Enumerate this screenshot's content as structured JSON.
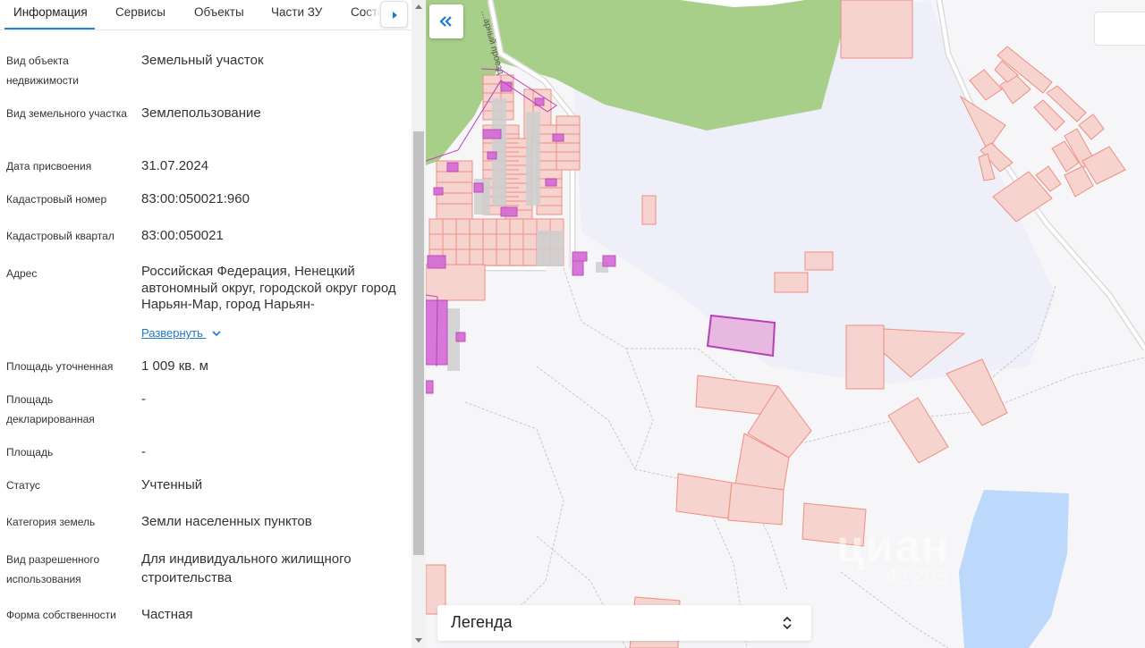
{
  "tabs": [
    {
      "label": "Информация",
      "active": true
    },
    {
      "label": "Сервисы",
      "active": false
    },
    {
      "label": "Объекты",
      "active": false
    },
    {
      "label": "Части ЗУ",
      "active": false
    },
    {
      "label": "Соста",
      "active": false
    }
  ],
  "info": [
    {
      "label": "Вид объекта недвижимости",
      "value": "Земельный участок"
    },
    {
      "label": "Вид земельного участка",
      "value": "Землепользование"
    },
    {
      "label": "Дата присвоения",
      "value": "31.07.2024"
    },
    {
      "label": "Кадастровый номер",
      "value": "83:00:050021:960"
    },
    {
      "label": "Кадастровый квартал",
      "value": "83:00:050021"
    },
    {
      "label": "Адрес",
      "value": "Российская Федерация, Ненецкий автономный округ, городской округ город Нарьян-Мар, город Нарьян-"
    },
    {
      "label": "Площадь уточненная",
      "value": "1 009 кв. м"
    },
    {
      "label": "Площадь декларированная",
      "value": "-"
    },
    {
      "label": "Площадь",
      "value": "-"
    },
    {
      "label": "Статус",
      "value": "Учтенный"
    },
    {
      "label": "Категория земель",
      "value": "Земли населенных пунктов"
    },
    {
      "label": "Вид разрешенного использования",
      "value": "Для индивидуального жилищного строительства"
    },
    {
      "label": "Форма собственности",
      "value": "Частная"
    }
  ],
  "address_expand_label": "Развернуть",
  "map": {
    "street_label": "…арный проезд",
    "legend_title": "Легенда",
    "watermark": "циан",
    "watermark_sub": "…41255"
  },
  "colors": {
    "accent": "#1f87d6",
    "parcel_fill": "#f6d3cf",
    "parcel_stroke": "#ee8f80",
    "selected_parcel": "#b83fb8",
    "forest": "#a8cf8a",
    "water": "#bcd9fb"
  }
}
